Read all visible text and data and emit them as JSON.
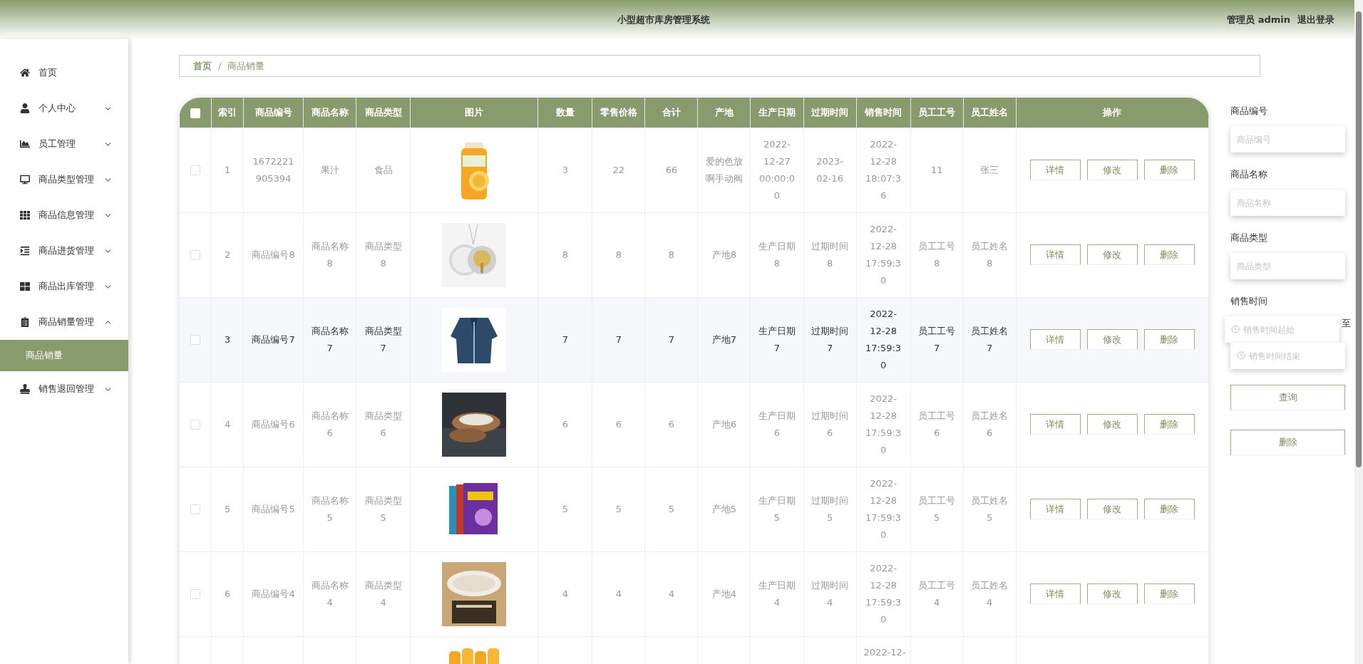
{
  "header": {
    "title": "小型超市库房管理系统",
    "user": "管理员 admin",
    "logout": "退出登录"
  },
  "sidebar": {
    "items": [
      {
        "label": "首页",
        "kind": "link"
      },
      {
        "label": "个人中心",
        "kind": "menu",
        "expanded": false
      },
      {
        "label": "员工管理",
        "kind": "menu",
        "expanded": false
      },
      {
        "label": "商品类型管理",
        "kind": "menu",
        "expanded": false
      },
      {
        "label": "商品信息管理",
        "kind": "menu",
        "expanded": false
      },
      {
        "label": "商品进货管理",
        "kind": "menu",
        "expanded": false
      },
      {
        "label": "商品出库管理",
        "kind": "menu",
        "expanded": false
      },
      {
        "label": "商品销量管理",
        "kind": "menu",
        "expanded": true,
        "children": [
          {
            "label": "商品销量",
            "selected": true
          }
        ]
      },
      {
        "label": "销售退回管理",
        "kind": "menu",
        "expanded": false
      }
    ]
  },
  "breadcrumb": {
    "items": [
      "首页",
      "商品销量"
    ],
    "separator": "/"
  },
  "table": {
    "select_all": {
      "checked": false
    },
    "columns": [
      "索引",
      "商品编号",
      "商品名称",
      "商品类型",
      "图片",
      "数量",
      "零售价格",
      "合计",
      "产地",
      "生产日期",
      "过期时间",
      "销售时间",
      "员工工号",
      "员工姓名",
      "操作"
    ],
    "rows": [
      {
        "checked": false,
        "hovered": false,
        "cells": [
          "1",
          "1672221905394",
          "果汁",
          "食品",
          {
            "kind": "picture"
          },
          "3",
          "22",
          "66",
          "爱的色放啊手动阀",
          "2022-12-27 00:00:00",
          "2023-02-16",
          "2022-12-28 18:07:36",
          "11",
          "张三"
        ],
        "actions": [
          "详情",
          "修改",
          "删除"
        ]
      },
      {
        "checked": false,
        "hovered": false,
        "cells": [
          "2",
          "商品编号8",
          "商品名称8",
          "商品类型8",
          {
            "kind": "picture"
          },
          "8",
          "8",
          "8",
          "产地8",
          "生产日期8",
          "过期时间8",
          "2022-12-28 17:59:30",
          "员工工号8",
          "员工姓名8"
        ],
        "actions": [
          "详情",
          "修改",
          "删除"
        ]
      },
      {
        "checked": false,
        "hovered": true,
        "cells": [
          "3",
          "商品编号7",
          "商品名称7",
          "商品类型7",
          {
            "kind": "picture"
          },
          "7",
          "7",
          "7",
          "产地7",
          "生产日期7",
          "过期时间7",
          "2022-12-28 17:59:30",
          "员工工号7",
          "员工姓名7"
        ],
        "actions": [
          "详情",
          "修改",
          "删除"
        ]
      },
      {
        "checked": false,
        "hovered": false,
        "cells": [
          "4",
          "商品编号6",
          "商品名称6",
          "商品类型6",
          {
            "kind": "picture"
          },
          "6",
          "6",
          "6",
          "产地6",
          "生产日期6",
          "过期时间6",
          "2022-12-28 17:59:30",
          "员工工号6",
          "员工姓名6"
        ],
        "actions": [
          "详情",
          "修改",
          "删除"
        ]
      },
      {
        "checked": false,
        "hovered": false,
        "cells": [
          "5",
          "商品编号5",
          "商品名称5",
          "商品类型5",
          {
            "kind": "picture"
          },
          "5",
          "5",
          "5",
          "产地5",
          "生产日期5",
          "过期时间5",
          "2022-12-28 17:59:30",
          "员工工号5",
          "员工姓名5"
        ],
        "actions": [
          "详情",
          "修改",
          "删除"
        ]
      },
      {
        "checked": false,
        "hovered": false,
        "cells": [
          "6",
          "商品编号4",
          "商品名称4",
          "商品类型4",
          {
            "kind": "picture"
          },
          "4",
          "4",
          "4",
          "产地4",
          "生产日期4",
          "过期时间4",
          "2022-12-28 17:59:30",
          "员工工号4",
          "员工姓名4"
        ],
        "actions": [
          "详情",
          "修改",
          "删除"
        ]
      },
      {
        "cells": [
          null,
          null,
          null,
          null,
          {
            "kind": "picture"
          },
          null,
          null,
          null,
          null,
          null,
          null,
          "2022-12-",
          null,
          null
        ]
      }
    ]
  },
  "filters": {
    "fields": [
      {
        "label": "商品编号",
        "placeholder": "商品编号"
      },
      {
        "label": "商品名称",
        "placeholder": "商品名称"
      },
      {
        "label": "商品类型",
        "placeholder": "商品类型"
      }
    ],
    "sale_time": {
      "label": "销售时间",
      "start_placeholder": "销售时间起始",
      "separator": "至",
      "end_placeholder": "销售时间结束"
    },
    "buttons": [
      "查询",
      "删除"
    ]
  }
}
